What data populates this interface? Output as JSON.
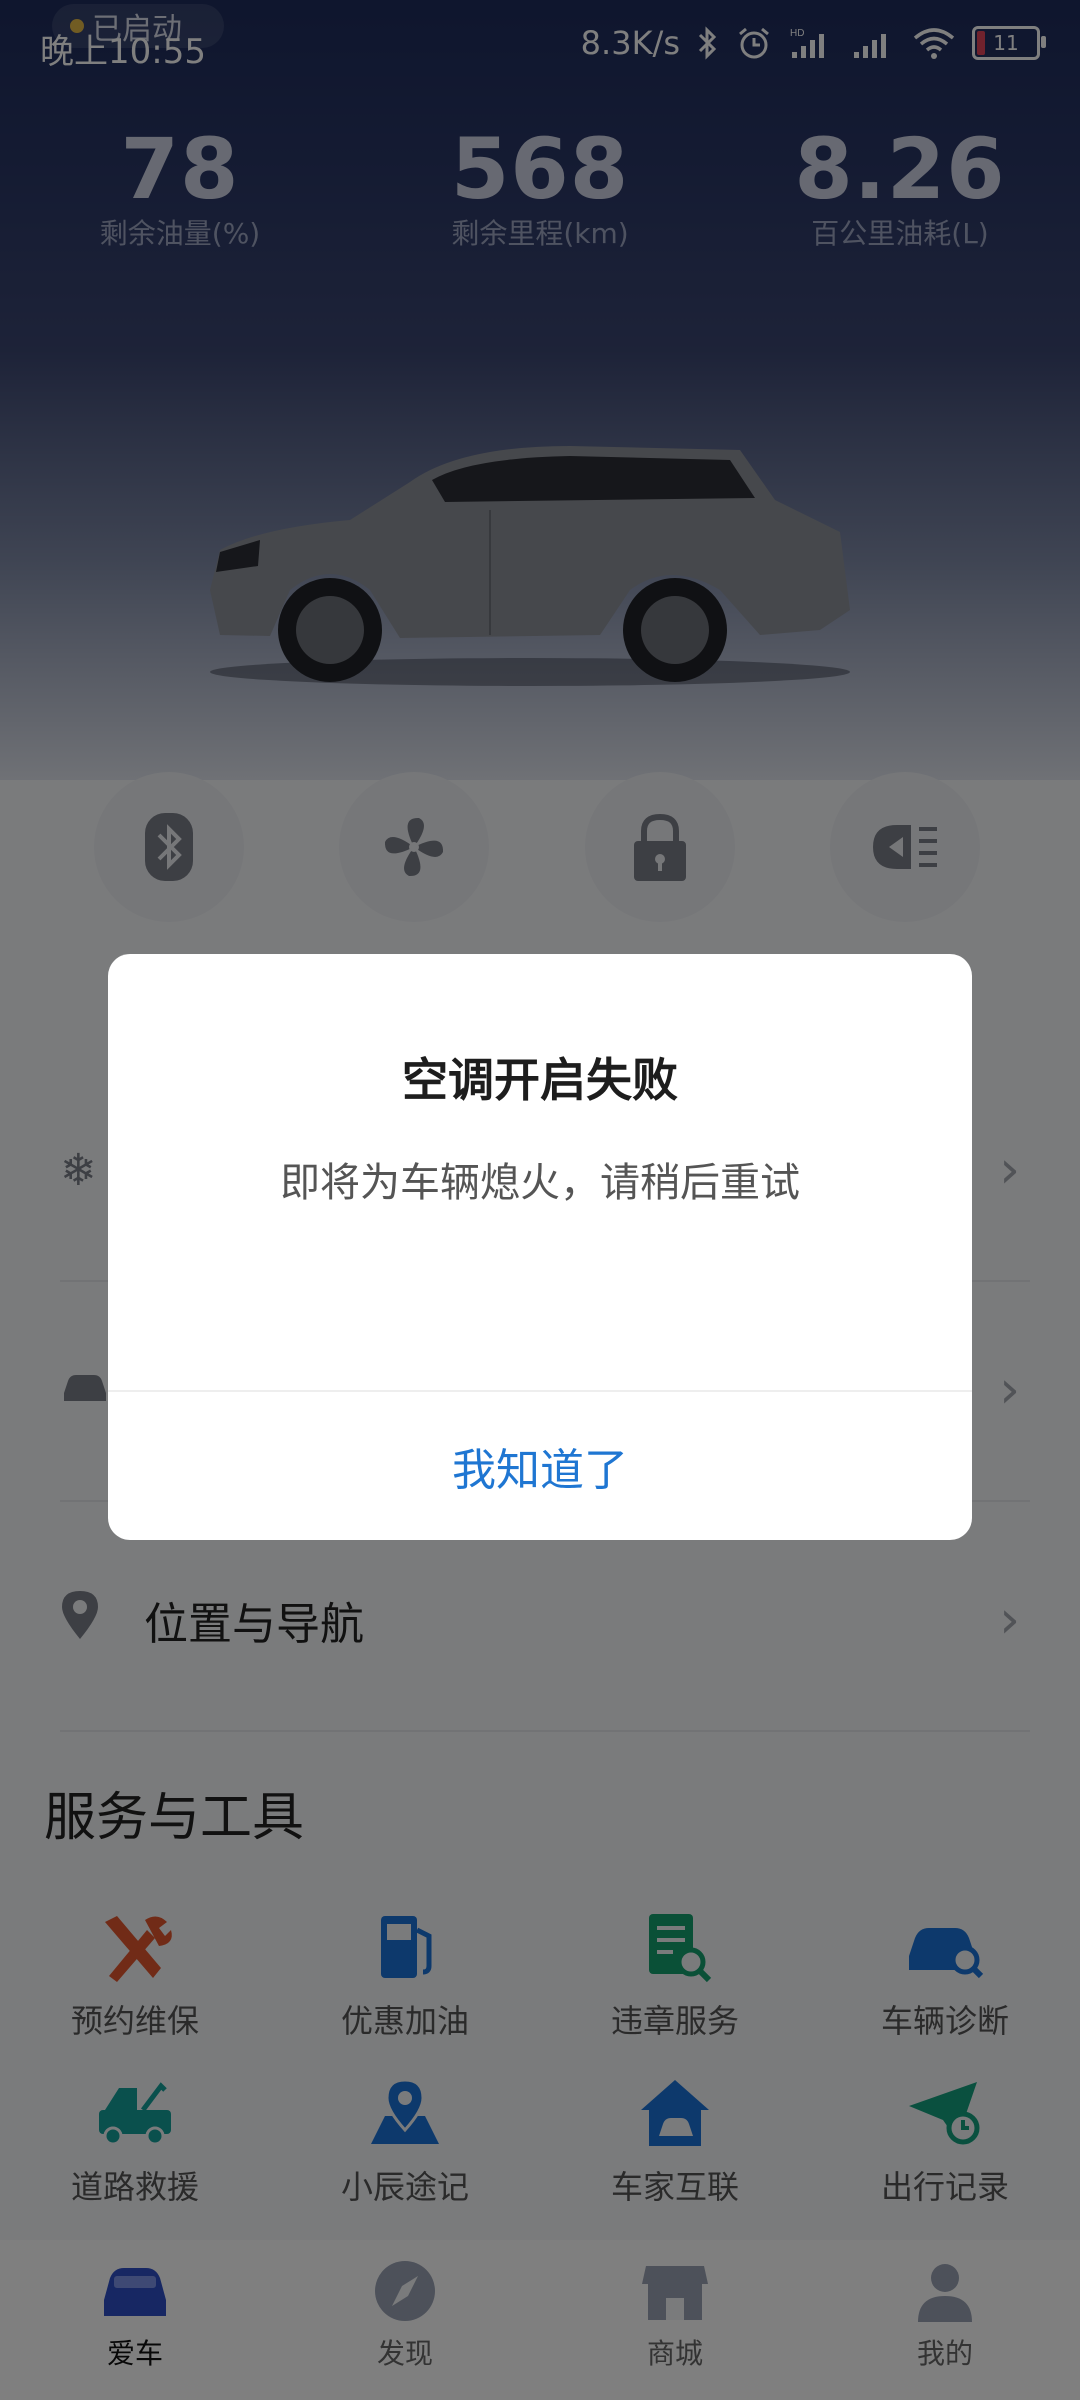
{
  "status_bar": {
    "time": "晚上10:55",
    "network_speed": "8.3K/s",
    "battery_level": "11",
    "icons": [
      "bluetooth-icon",
      "alarm-icon",
      "hd-signal-icon",
      "signal-icon",
      "wifi-icon",
      "battery-icon"
    ]
  },
  "engine_status": {
    "label": "已启动"
  },
  "stats": [
    {
      "value": "78",
      "label": "剩余油量(%)"
    },
    {
      "value": "568",
      "label": "剩余里程(km)"
    },
    {
      "value": "8.26",
      "label": "百公里油耗(L)"
    }
  ],
  "quick_actions": [
    "bluetooth-key-icon",
    "fan-icon",
    "lock-icon",
    "horn-lights-icon"
  ],
  "menu": [
    {
      "icon": "snowflake-icon"
    },
    {
      "icon": "car-icon"
    },
    {
      "icon": "location-pin-icon",
      "label": "位置与导航"
    }
  ],
  "services": {
    "title": "服务与工具",
    "items": [
      {
        "label": "预约维保",
        "icon": "tools-icon",
        "color": "#e2572f"
      },
      {
        "label": "优惠加油",
        "icon": "fuel-pump-icon",
        "color": "#1a73d8"
      },
      {
        "label": "违章服务",
        "icon": "document-search-icon",
        "color": "#14a06e"
      },
      {
        "label": "车辆诊断",
        "icon": "car-diagnosis-icon",
        "color": "#1a73d8"
      },
      {
        "label": "道路救援",
        "icon": "tow-truck-icon",
        "color": "#14a09a"
      },
      {
        "label": "小辰途记",
        "icon": "map-pin-icon",
        "color": "#1a73d8"
      },
      {
        "label": "车家互联",
        "icon": "home-car-icon",
        "color": "#1a73d8"
      },
      {
        "label": "出行记录",
        "icon": "paper-plane-clock-icon",
        "color": "#14a07e"
      }
    ]
  },
  "tabbar": [
    {
      "label": "爱车",
      "icon": "car-tab-icon",
      "active": true
    },
    {
      "label": "发现",
      "icon": "compass-icon"
    },
    {
      "label": "商城",
      "icon": "store-icon"
    },
    {
      "label": "我的",
      "icon": "user-icon"
    }
  ],
  "dialog": {
    "title": "空调开启失败",
    "message": "即将为车辆熄火，请稍后重试",
    "confirm_label": "我知道了"
  }
}
